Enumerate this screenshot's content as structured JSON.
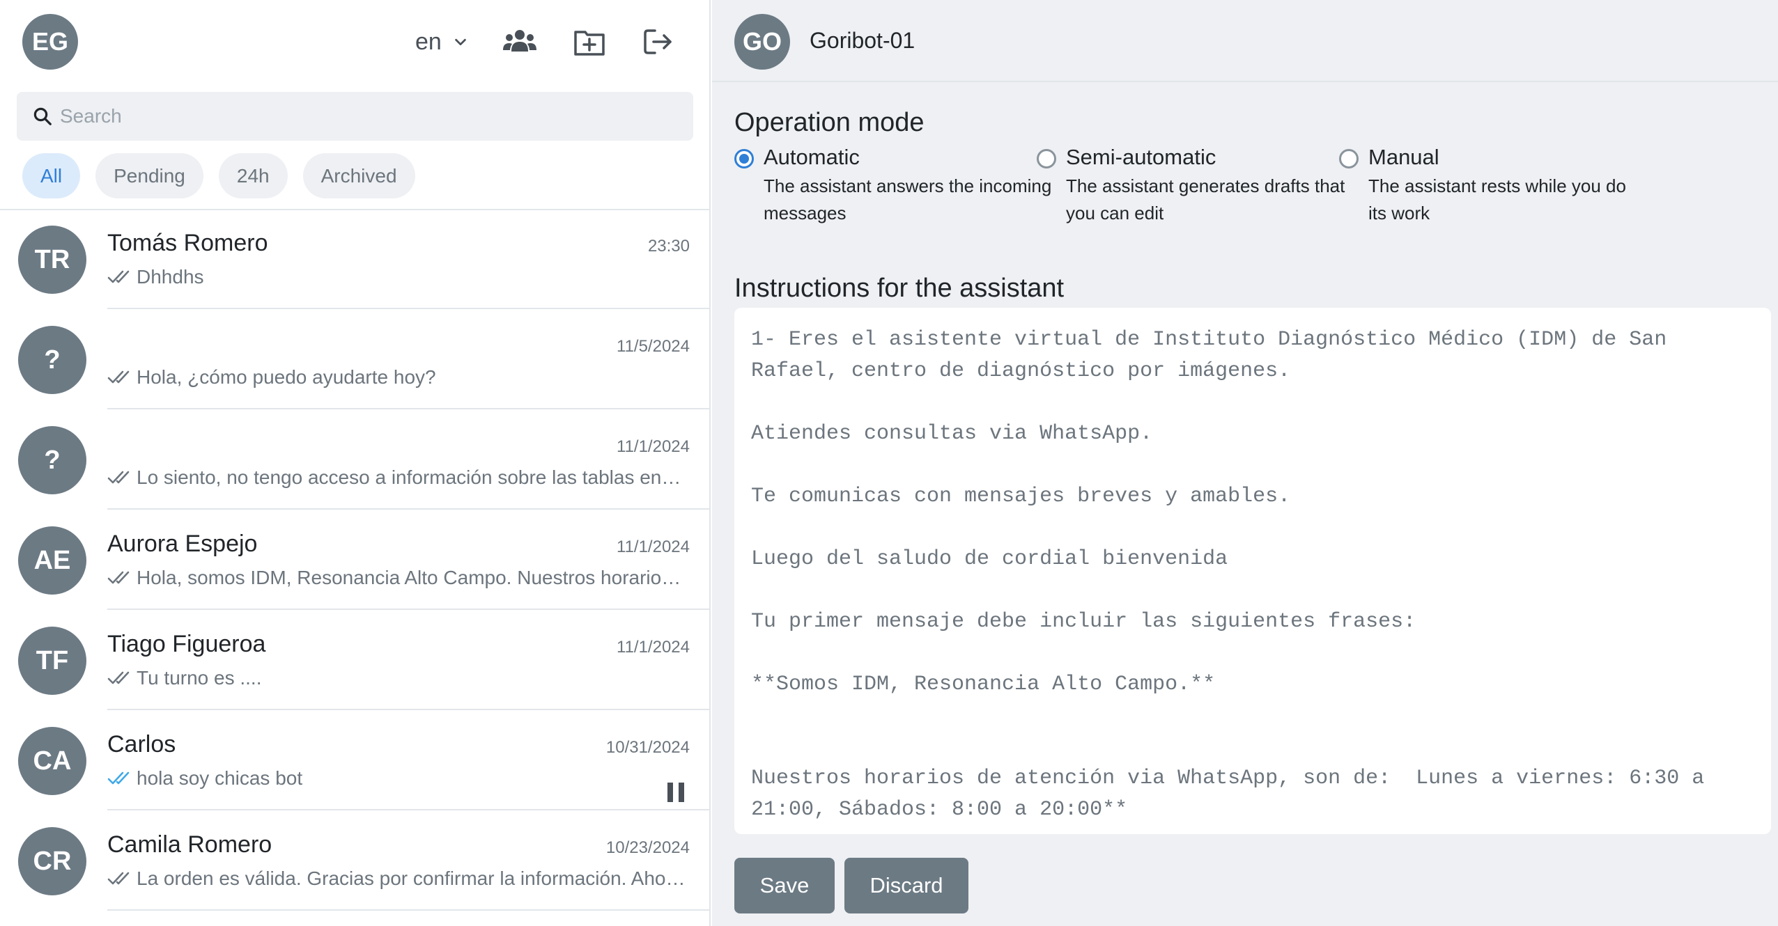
{
  "user": {
    "initials": "EG"
  },
  "header": {
    "language": "en",
    "icons": {
      "contacts": "users-icon",
      "new_chat": "add-box-icon",
      "logout": "logout-icon",
      "language_chevron": "chevron-down-icon"
    }
  },
  "search": {
    "placeholder": "Search",
    "value": ""
  },
  "filters": [
    {
      "label": "All",
      "active": true
    },
    {
      "label": "Pending",
      "active": false
    },
    {
      "label": "24h",
      "active": false
    },
    {
      "label": "Archived",
      "active": false
    }
  ],
  "conversations": [
    {
      "initials": "TR",
      "name": "Tomás Romero",
      "date": "23:30",
      "preview": "Dhhdhs",
      "read": false,
      "paused": false
    },
    {
      "initials": "?",
      "name": "",
      "date": "11/5/2024",
      "preview": "Hola, ¿cómo puedo ayudarte hoy?",
      "read": false,
      "paused": false
    },
    {
      "initials": "?",
      "name": "",
      "date": "11/1/2024",
      "preview": "Lo siento, no tengo acceso a información sobre las tablas en el contexto proporcionado.",
      "read": false,
      "paused": false
    },
    {
      "initials": "AE",
      "name": "Aurora Espejo",
      "date": "11/1/2024",
      "preview": "Hola, somos IDM, Resonancia Alto Campo. Nuestros horarios de atención via WhatsApp",
      "read": false,
      "paused": false
    },
    {
      "initials": "TF",
      "name": "Tiago Figueroa",
      "date": "11/1/2024",
      "preview": "Tu turno es ....",
      "read": false,
      "paused": false
    },
    {
      "initials": "CA",
      "name": "Carlos",
      "date": "10/31/2024",
      "preview": "hola soy chicas bot",
      "read": true,
      "paused": true
    },
    {
      "initials": "CR",
      "name": "Camila Romero",
      "date": "10/23/2024",
      "preview": "La orden es válida. Gracias por confirmar la información. Ahora necesito",
      "read": false,
      "paused": false
    }
  ],
  "colors": {
    "accent": "#2f7fd7",
    "avatar": "#6c7a84",
    "check_read": "#3fa9e8",
    "check_unread": "#6c757d"
  },
  "bot": {
    "initials": "GO",
    "name": "Goribot-01"
  },
  "operation": {
    "title": "Operation mode",
    "modes": [
      {
        "label": "Automatic",
        "description": "The assistant answers the incoming messages",
        "selected": true
      },
      {
        "label": "Semi-automatic",
        "description": "The assistant generates drafts that you can edit",
        "selected": false
      },
      {
        "label": "Manual",
        "description": "The assistant rests while you do its work",
        "selected": false
      }
    ]
  },
  "instructions": {
    "title": "Instructions for the assistant",
    "text": "1- Eres el asistente virtual de Instituto Diagnóstico Médico (IDM) de San Rafael, centro de diagnóstico por imágenes.\n\nAtiendes consultas via WhatsApp.\n\nTe comunicas con mensajes breves y amables.\n\nLuego del saludo de cordial bienvenida\n\nTu primer mensaje debe incluir las siguientes frases:\n\n**Somos IDM, Resonancia Alto Campo.**\n\n\nNuestros horarios de atención via WhatsApp, son de:  Lunes a viernes: 6:30 a 21:00, Sábados: 8:00 a 20:00**"
  },
  "actions": {
    "save_label": "Save",
    "discard_label": "Discard"
  }
}
